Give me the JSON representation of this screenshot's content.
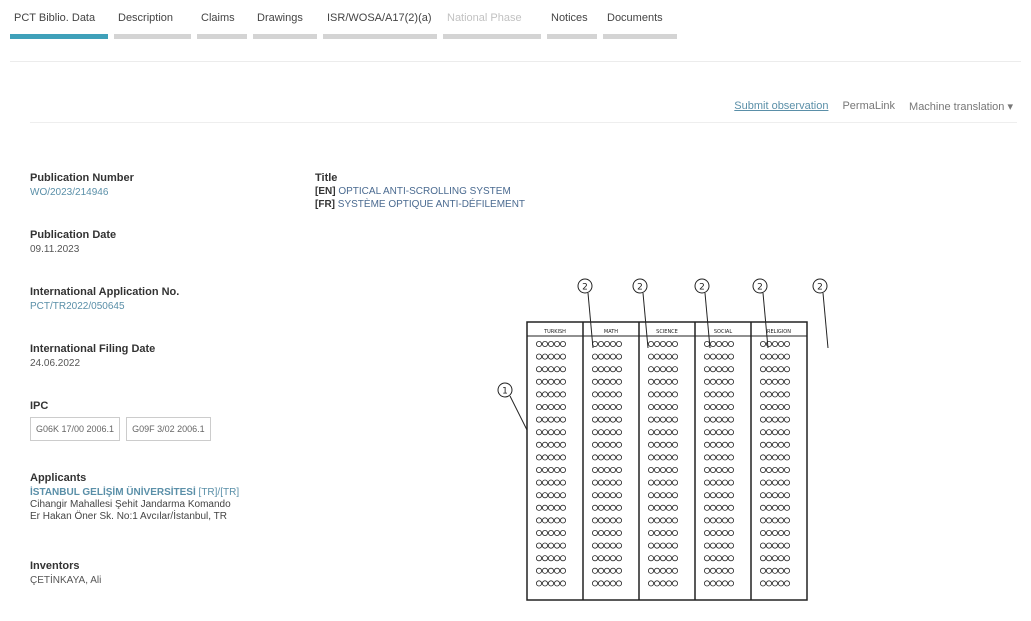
{
  "tabs": [
    {
      "label": "PCT Biblio. Data",
      "active": true
    },
    {
      "label": "Description"
    },
    {
      "label": "Claims"
    },
    {
      "label": "Drawings"
    },
    {
      "label": "ISR/WOSA/A17(2)(a)"
    },
    {
      "label": "National Phase",
      "disabled": true
    },
    {
      "label": "Notices"
    },
    {
      "label": "Documents"
    }
  ],
  "links": {
    "submit": "Submit observation",
    "permalink": "PermaLink",
    "machine": "Machine translation ▾"
  },
  "biblio": {
    "pub_no_label": "Publication Number",
    "pub_no": "WO/2023/214946",
    "pub_date_label": "Publication Date",
    "pub_date": "09.11.2023",
    "app_no_label": "International Application No.",
    "app_no": "PCT/TR2022/050645",
    "filing_label": "International Filing Date",
    "filing": "24.06.2022",
    "ipc_label": "IPC",
    "ipc": [
      "G06K 17/00 2006.1",
      "G09F 3/02 2006.1"
    ],
    "applicants_label": "Applicants",
    "applicant_name": "İSTANBUL GELİŞİM ÜNİVERSİTESİ",
    "applicant_cc": "[TR]/[TR]",
    "applicant_addr1": "Cihangir Mahallesi Şehit Jandarma Komando",
    "applicant_addr2": "Er Hakan Öner Sk. No:1 Avcılar/İstanbul, TR",
    "inventors_label": "Inventors",
    "inventor": "ÇETİNKAYA, Ali"
  },
  "title": {
    "label": "Title",
    "en_tag": "[EN]",
    "en": "OPTICAL ANTI-SCROLLING SYSTEM",
    "fr_tag": "[FR]",
    "fr": "SYSTÈME OPTIQUE ANTI-DÉFILEMENT"
  },
  "figure": {
    "ref_numbers": [
      "2",
      "2",
      "2",
      "2",
      "2",
      "1"
    ],
    "columns": [
      "TURKISH",
      "MATH",
      "SCIENCE",
      "SOCIAL",
      "RELIGION"
    ]
  }
}
